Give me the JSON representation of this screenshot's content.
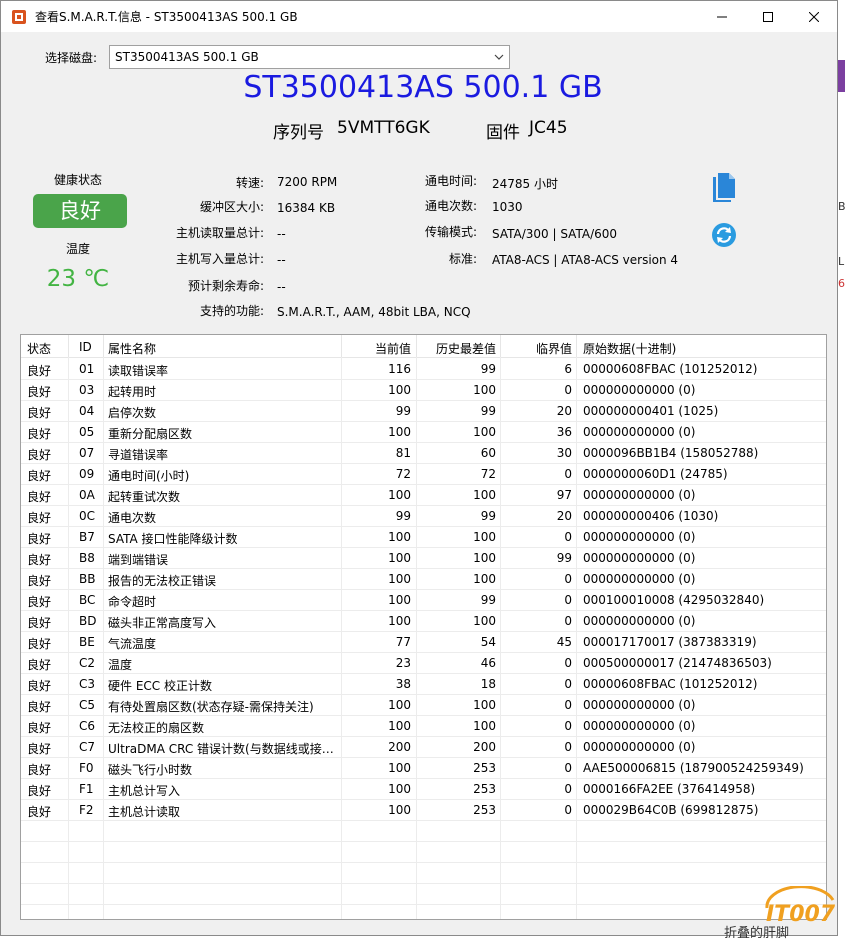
{
  "window": {
    "title": "查看S.M.A.R.T.信息 - ST3500413AS 500.1 GB"
  },
  "disk_select": {
    "label": "选择磁盘:",
    "value": "ST3500413AS 500.1 GB"
  },
  "disk": {
    "model": "ST3500413AS 500.1 GB",
    "serial_label": "序列号",
    "serial": "5VMTT6GK",
    "firmware_label": "固件",
    "firmware": "JC45"
  },
  "health": {
    "label": "健康状态",
    "value": "良好",
    "color": "#4aa44a",
    "temp_label": "温度",
    "temp": "23 ℃",
    "temp_color": "#43b443"
  },
  "info": {
    "rpm_label": "转速:",
    "rpm": "7200 RPM",
    "buffer_label": "缓冲区大小:",
    "buffer": "16384 KB",
    "host_read_label": "主机读取量总计:",
    "host_read": "--",
    "host_write_label": "主机写入量总计:",
    "host_write": "--",
    "life_label": "预计剩余寿命:",
    "life": "--",
    "features_label": "支持的功能:",
    "features": "S.M.A.R.T., AAM, 48bit LBA, NCQ",
    "power_on_hours_label": "通电时间:",
    "power_on_hours": "24785 小时",
    "power_count_label": "通电次数:",
    "power_count": "1030",
    "transfer_label": "传输模式:",
    "transfer": "SATA/300 | SATA/600",
    "standard_label": "标准:",
    "standard": "ATA8-ACS | ATA8-ACS version 4"
  },
  "icons": {
    "copy": "copy-document-icon",
    "refresh": "refresh-icon"
  },
  "table": {
    "headers": [
      "状态",
      "ID",
      "属性名称",
      "当前值",
      "历史最差值",
      "临界值",
      "原始数据(十进制)"
    ],
    "rows": [
      [
        "良好",
        "01",
        "读取错误率",
        "116",
        "99",
        "6",
        "00000608FBAC (101252012)"
      ],
      [
        "良好",
        "03",
        "起转用时",
        "100",
        "100",
        "0",
        "000000000000 (0)"
      ],
      [
        "良好",
        "04",
        "启停次数",
        "99",
        "99",
        "20",
        "000000000401 (1025)"
      ],
      [
        "良好",
        "05",
        "重新分配扇区数",
        "100",
        "100",
        "36",
        "000000000000 (0)"
      ],
      [
        "良好",
        "07",
        "寻道错误率",
        "81",
        "60",
        "30",
        "0000096BB1B4 (158052788)"
      ],
      [
        "良好",
        "09",
        "通电时间(小时)",
        "72",
        "72",
        "0",
        "0000000060D1 (24785)"
      ],
      [
        "良好",
        "0A",
        "起转重试次数",
        "100",
        "100",
        "97",
        "000000000000 (0)"
      ],
      [
        "良好",
        "0C",
        "通电次数",
        "99",
        "99",
        "20",
        "000000000406 (1030)"
      ],
      [
        "良好",
        "B7",
        "SATA 接口性能降级计数",
        "100",
        "100",
        "0",
        "000000000000 (0)"
      ],
      [
        "良好",
        "B8",
        "端到端错误",
        "100",
        "100",
        "99",
        "000000000000 (0)"
      ],
      [
        "良好",
        "BB",
        "报告的无法校正错误",
        "100",
        "100",
        "0",
        "000000000000 (0)"
      ],
      [
        "良好",
        "BC",
        "命令超时",
        "100",
        "99",
        "0",
        "000100010008 (4295032840)"
      ],
      [
        "良好",
        "BD",
        "磁头非正常高度写入",
        "100",
        "100",
        "0",
        "000000000000 (0)"
      ],
      [
        "良好",
        "BE",
        "气流温度",
        "77",
        "54",
        "45",
        "000017170017 (387383319)"
      ],
      [
        "良好",
        "C2",
        "温度",
        "23",
        "46",
        "0",
        "000500000017 (21474836503)"
      ],
      [
        "良好",
        "C3",
        "硬件 ECC 校正计数",
        "38",
        "18",
        "0",
        "00000608FBAC (101252012)"
      ],
      [
        "良好",
        "C5",
        "有待处置扇区数(状态存疑-需保持关注)",
        "100",
        "100",
        "0",
        "000000000000 (0)"
      ],
      [
        "良好",
        "C6",
        "无法校正的扇区数",
        "100",
        "100",
        "0",
        "000000000000 (0)"
      ],
      [
        "良好",
        "C7",
        "UltraDMA CRC 错误计数(与数据线或接…",
        "200",
        "200",
        "0",
        "000000000000 (0)"
      ],
      [
        "良好",
        "F0",
        "磁头飞行小时数",
        "100",
        "253",
        "0",
        "AAE500006815 (187900524259349)"
      ],
      [
        "良好",
        "F1",
        "主机总计写入",
        "100",
        "253",
        "0",
        "0000166FA2EE (376414958)"
      ],
      [
        "良好",
        "F2",
        "主机总计读取",
        "100",
        "253",
        "0",
        "000029B64C0B (699812875)"
      ]
    ]
  },
  "background": {
    "frag_b": "B",
    "frag_l": "L",
    "frag_6": "6",
    "bottom_text": "折叠的肝脚",
    "watermark": "IT007"
  }
}
